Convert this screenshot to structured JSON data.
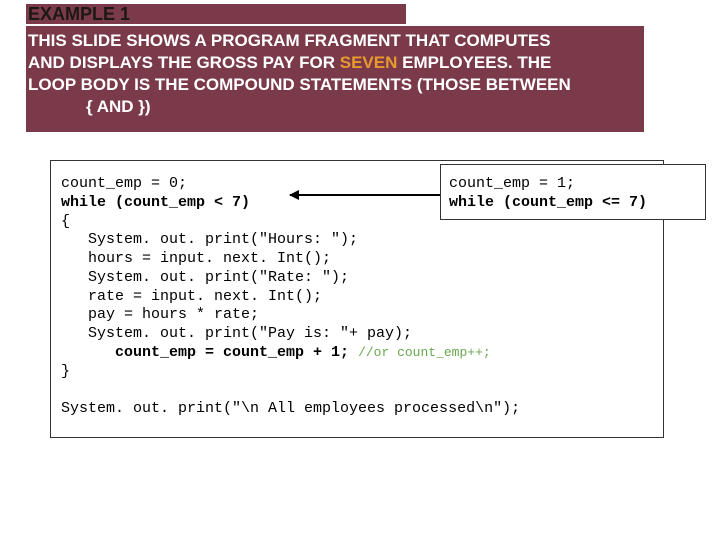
{
  "header": {
    "title": "EXAMPLE 1"
  },
  "description": {
    "line1": "THIS SLIDE SHOWS A PROGRAM FRAGMENT THAT COMPUTES",
    "line2a": "AND DISPLAYS THE GROSS PAY FOR ",
    "line2b": "SEVEN",
    "line2c": " EMPLOYEES. THE",
    "line3": "LOOP BODY IS THE COMPOUND STATEMENTS (THOSE BETWEEN",
    "line4": "{ AND })"
  },
  "code": {
    "l1": "count_emp = 0;",
    "l2a": "while",
    "l2b": " (count_emp < 7)",
    "l3": "{",
    "l4": "   System. out. print(\"Hours: \");",
    "l5": "   hours = input. next. Int();",
    "l6": "   System. out. print(\"Rate: \");",
    "l7": "   rate = input. next. Int();",
    "l8": "   pay = hours * rate;",
    "l9": "   System. out. print(\"Pay is: \"+ pay);",
    "l10a": "      count_emp = count_emp + 1; ",
    "l10b": "//or count_emp++;",
    "l11": "}",
    "l12": "",
    "l13": "System. out. print(\"\\n All employees processed\\n\");"
  },
  "alt": {
    "l1": "count_emp = 1;",
    "l2a": "while",
    "l2b": " (count_emp <= 7)"
  }
}
